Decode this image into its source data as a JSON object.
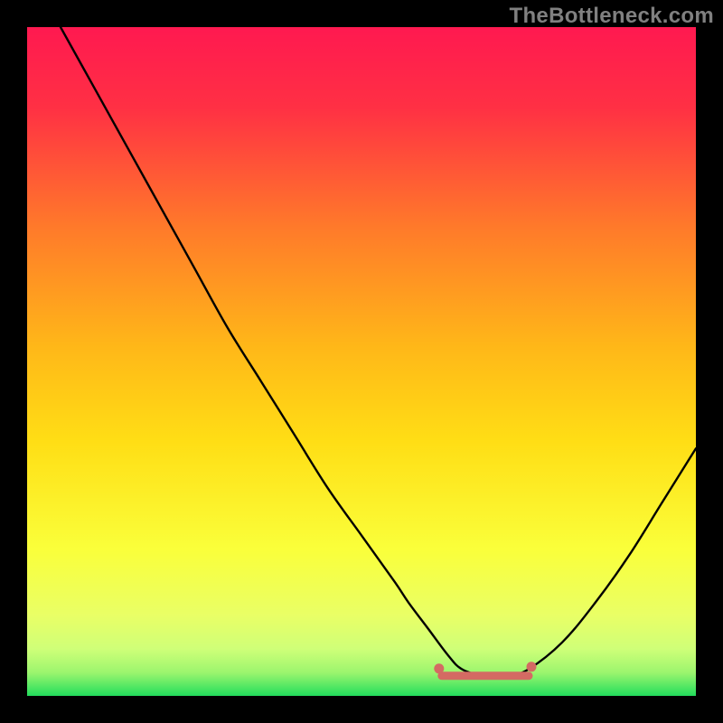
{
  "watermark": "TheBottleneck.com",
  "colors": {
    "gradient_top": "#FF1A4C",
    "gradient_mid": "#FFD200",
    "gradient_low": "#F6FF80",
    "gradient_bottom": "#28E060",
    "curve": "#000000",
    "marker_fill": "#D46A63",
    "marker_stroke": "#D46A63",
    "background": "#000000"
  },
  "chart_data": {
    "type": "line",
    "title": "",
    "xlabel": "",
    "ylabel": "",
    "xlim": [
      0,
      100
    ],
    "ylim": [
      0,
      100
    ],
    "grid": false,
    "legend_position": "none",
    "series": [
      {
        "name": "bottleneck_curve",
        "x": [
          5,
          10,
          15,
          20,
          25,
          30,
          35,
          40,
          45,
          50,
          55,
          57,
          60,
          63,
          65,
          68,
          70,
          72,
          75,
          80,
          85,
          90,
          95,
          100
        ],
        "y": [
          100,
          91,
          82,
          73,
          64,
          55,
          47,
          39,
          31,
          24,
          17,
          14,
          10,
          6,
          4,
          3,
          3,
          3,
          4,
          8,
          14,
          21,
          29,
          37
        ]
      }
    ],
    "highlight_range": {
      "x_start": 62,
      "x_end": 75,
      "y": 3
    }
  }
}
